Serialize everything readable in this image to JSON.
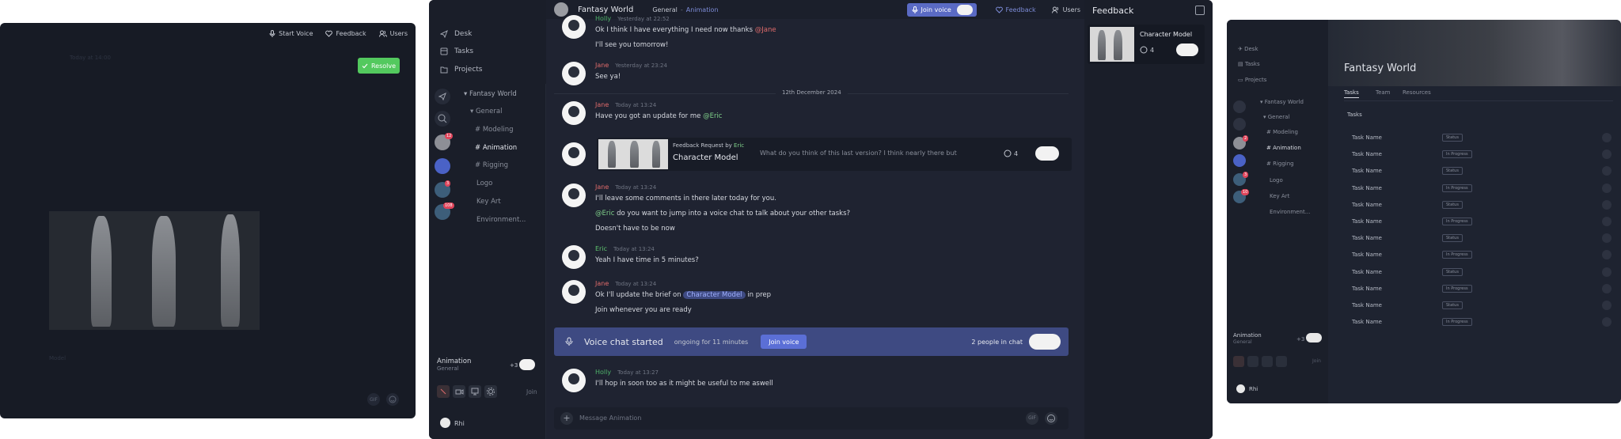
{
  "left": {
    "topbar": {
      "start_voice": "Start Voice",
      "feedback": "Feedback",
      "users": "Users"
    },
    "resolve_label": "Resolve",
    "dim_title": "Today at 14:00",
    "dim_footer": "Model"
  },
  "main": {
    "nav": {
      "desk": "Desk",
      "tasks": "Tasks",
      "projects": "Projects"
    },
    "tree": {
      "project": "Fantasy World",
      "items": [
        "General",
        "Modeling",
        "Animation",
        "Rigging",
        "Logo",
        "Key Art",
        "Environment..."
      ]
    },
    "rail_badges": [
      "12",
      "3",
      "108"
    ],
    "bottom": {
      "channel": "Animation",
      "group": "General",
      "plus": "+3",
      "join": "Join",
      "user": "Rhi"
    },
    "header": {
      "project": "Fantasy World",
      "breadcrumb_general": "General",
      "breadcrumb_sep": "-",
      "breadcrumb_channel": "Animation",
      "join_voice": "Join voice",
      "feedback": "Feedback",
      "users": "Users"
    },
    "messages": [
      {
        "name": "Holly",
        "time": "Yesterday at 22:52",
        "text": "Ok I think I have everything I need now thanks",
        "mention": "@Jane",
        "text2": "I'll see you tomorrow!"
      },
      {
        "name": "Jane",
        "time": "Yesterday at 23:24",
        "text": "See ya!"
      },
      {
        "name": "Jane",
        "time": "Today at 13:24",
        "text": "Have you got an update for me",
        "mention": "@Eric"
      },
      {
        "name": "Jane",
        "time": "Today at 13:24",
        "text": "I'll leave some comments in there later today for you.",
        "mention": "@Eric",
        "text2": "do you want to jump into a voice chat to talk about your other tasks?",
        "text3": "Doesn't have to be now"
      },
      {
        "name": "Eric",
        "time": "Today at 13:24",
        "text": "Yeah I have time in 5 minutes?"
      },
      {
        "name": "Jane",
        "time": "Today at 13:24",
        "text": "Ok I'll update the brief on",
        "chip": "Character Model",
        "text_after": "in prep",
        "text2": "Join whenever you are ready"
      },
      {
        "name": "Holly",
        "time": "Today at 13:27",
        "text": "I'll hop in soon too as it might be useful to me aswell"
      }
    ],
    "date_divider": "12th December 2024",
    "feedback_card": {
      "label": "Feedback Request by",
      "by": "Eric",
      "title": "Character Model",
      "question": "What do you think of this last version? I think nearly there but",
      "count": "4"
    },
    "voice_banner": {
      "title": "Voice chat started",
      "duration": "ongoing for 11 minutes",
      "button": "Join voice",
      "people": "2 people in chat"
    },
    "input": {
      "placeholder": "Message Animation",
      "gif": "GIF"
    },
    "feedback_panel": {
      "title": "Feedback",
      "item_title": "Character Model",
      "count": "4"
    }
  },
  "right": {
    "nav": {
      "desk": "Desk",
      "tasks": "Tasks",
      "projects": "Projects"
    },
    "tree": {
      "project": "Fantasy World",
      "items": [
        "General",
        "Modeling",
        "Animation",
        "Rigging",
        "Logo",
        "Key Art",
        "Environment..."
      ]
    },
    "rail_badges": [
      "2",
      "3",
      "10"
    ],
    "banner_title": "Fantasy World",
    "tabs": [
      "Tasks",
      "Team",
      "Resources"
    ],
    "section": "Tasks",
    "rows": [
      {
        "name": "Task Name",
        "status": "Status"
      },
      {
        "name": "Task Name",
        "status": "In Progress"
      },
      {
        "name": "Task Name",
        "status": "Status"
      },
      {
        "name": "Task Name",
        "status": "In Progress"
      },
      {
        "name": "Task Name",
        "status": "Status"
      },
      {
        "name": "Task Name",
        "status": "In Progress"
      },
      {
        "name": "Task Name",
        "status": "Status"
      },
      {
        "name": "Task Name",
        "status": "In Progress"
      },
      {
        "name": "Task Name",
        "status": "Status"
      },
      {
        "name": "Task Name",
        "status": "In Progress"
      },
      {
        "name": "Task Name",
        "status": "Status"
      },
      {
        "name": "Task Name",
        "status": "In Progress"
      }
    ],
    "bottom": {
      "channel": "Animation",
      "group": "General",
      "plus": "+3",
      "join": "Join",
      "user": "Rhi"
    }
  },
  "colors": {
    "bg": "#1a1e29",
    "accent": "#5b6fd6",
    "green": "#53c95e",
    "voice": "#3e4a82",
    "holly": "#4fb36a",
    "jane": "#e06b6b",
    "eric": "#5fc46e",
    "mention": "#7fd08a"
  }
}
